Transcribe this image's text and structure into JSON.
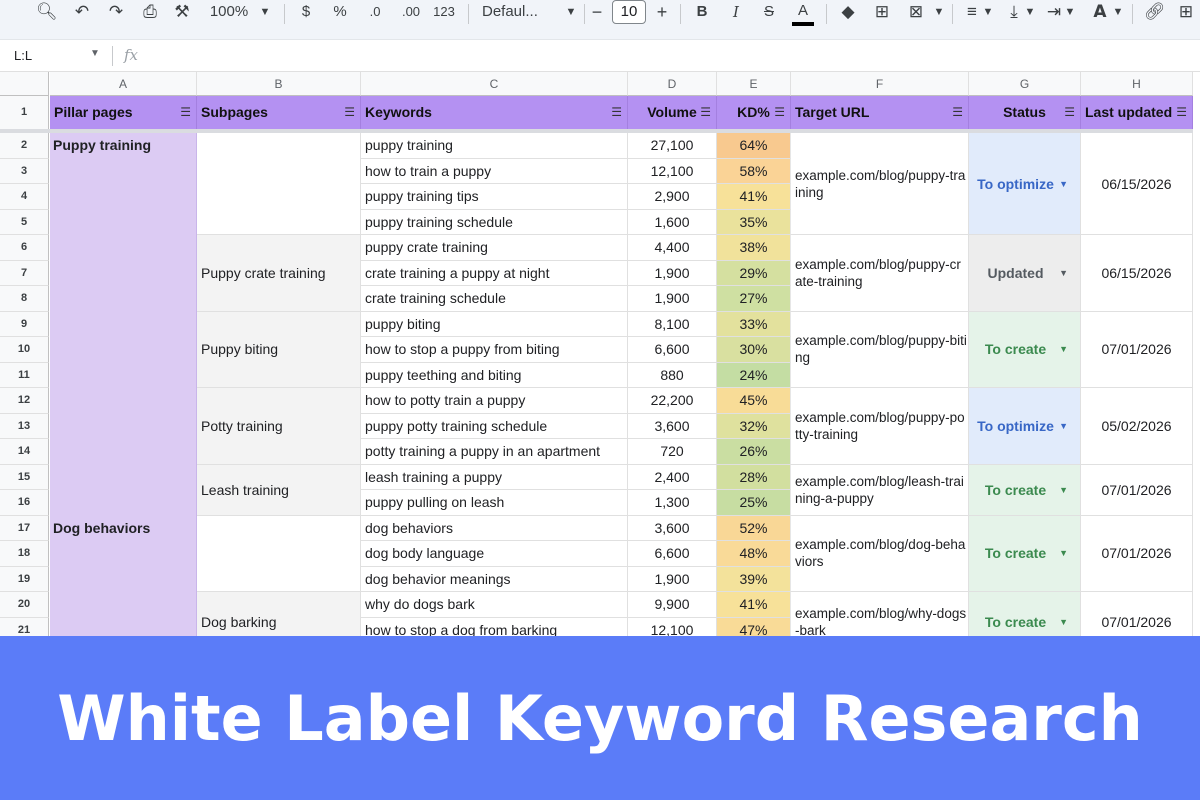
{
  "toolbar": {
    "zoom": "100%",
    "currency": "$",
    "percent": "%",
    "decrease_decimal": ".0",
    "increase_decimal": ".00",
    "more_formats": "123",
    "font": "Defaul...",
    "font_size": "10",
    "bold": "B",
    "italic": "I",
    "strikethrough": "S",
    "text_color": "A",
    "minus": "−",
    "plus": "+"
  },
  "formula_bar": {
    "name_box": "L:L",
    "fx": "fx"
  },
  "columns": [
    "A",
    "B",
    "C",
    "D",
    "E",
    "F",
    "G",
    "H"
  ],
  "rows": [
    "1",
    "2",
    "3",
    "4",
    "5",
    "6",
    "7",
    "8",
    "9",
    "10",
    "11",
    "12",
    "13",
    "14",
    "15",
    "16",
    "17",
    "18",
    "19",
    "20",
    "21"
  ],
  "headers": {
    "pillar": "Pillar pages",
    "subpages": "Subpages",
    "keywords": "Keywords",
    "volume": "Volume",
    "kd": "KD%",
    "url": "Target URL",
    "status": "Status",
    "updated": "Last updated"
  },
  "keywords": [
    {
      "keyword": "puppy training",
      "volume": "27,100",
      "kd": "64%",
      "kd_color": "#f8c98f"
    },
    {
      "keyword": "how to train a puppy",
      "volume": "12,100",
      "kd": "58%",
      "kd_color": "#fad396"
    },
    {
      "keyword": "puppy training tips",
      "volume": "2,900",
      "kd": "41%",
      "kd_color": "#f7e199"
    },
    {
      "keyword": "puppy training schedule",
      "volume": "1,600",
      "kd": "35%",
      "kd_color": "#eae29c"
    },
    {
      "keyword": "puppy crate training",
      "volume": "4,400",
      "kd": "38%",
      "kd_color": "#f1e29b"
    },
    {
      "keyword": "crate training a puppy at night",
      "volume": "1,900",
      "kd": "29%",
      "kd_color": "#d5e0a0"
    },
    {
      "keyword": "crate training schedule",
      "volume": "1,900",
      "kd": "27%",
      "kd_color": "#cfe0a2"
    },
    {
      "keyword": "puppy biting",
      "volume": "8,100",
      "kd": "33%",
      "kd_color": "#e3e19d"
    },
    {
      "keyword": "how to stop a puppy from biting",
      "volume": "6,600",
      "kd": "30%",
      "kd_color": "#d9e0a0"
    },
    {
      "keyword": "puppy teething and biting",
      "volume": "880",
      "kd": "24%",
      "kd_color": "#c4dda3"
    },
    {
      "keyword": "how to potty train a puppy",
      "volume": "22,200",
      "kd": "45%",
      "kd_color": "#f8dc97"
    },
    {
      "keyword": "puppy potty training schedule",
      "volume": "3,600",
      "kd": "32%",
      "kd_color": "#dfe19e"
    },
    {
      "keyword": "potty training a puppy in an apartment",
      "volume": "720",
      "kd": "26%",
      "kd_color": "#cadea2"
    },
    {
      "keyword": "leash training a puppy",
      "volume": "2,400",
      "kd": "28%",
      "kd_color": "#d2df9f"
    },
    {
      "keyword": "puppy pulling on leash",
      "volume": "1,300",
      "kd": "25%",
      "kd_color": "#c7dda2"
    },
    {
      "keyword": "dog behaviors",
      "volume": "3,600",
      "kd": "52%",
      "kd_color": "#f9d796"
    },
    {
      "keyword": "dog body language",
      "volume": "6,600",
      "kd": "48%",
      "kd_color": "#f9da98"
    },
    {
      "keyword": "dog behavior meanings",
      "volume": "1,900",
      "kd": "39%",
      "kd_color": "#f3e29b"
    },
    {
      "keyword": "why do dogs bark",
      "volume": "9,900",
      "kd": "41%",
      "kd_color": "#f7e199"
    },
    {
      "keyword": "how to stop a dog from barking",
      "volume": "12,100",
      "kd": "47%",
      "kd_color": "#f9db97"
    }
  ],
  "pillars": [
    {
      "label": "Puppy training"
    },
    {
      "label": "Dog behaviors"
    }
  ],
  "subpages": [
    {
      "label": ""
    },
    {
      "label": "Puppy crate training"
    },
    {
      "label": "Puppy biting"
    },
    {
      "label": "Potty training"
    },
    {
      "label": "Leash training"
    },
    {
      "label": ""
    },
    {
      "label": "Dog barking"
    }
  ],
  "groups": [
    {
      "url": "example.com/blog/puppy-training",
      "status": "To optimize",
      "status_kind": "optimize",
      "updated": "06/15/2026"
    },
    {
      "url": "example.com/blog/puppy-crate-training",
      "status": "Updated",
      "status_kind": "updated",
      "updated": "06/15/2026"
    },
    {
      "url": "example.com/blog/puppy-biting",
      "status": "To create",
      "status_kind": "create",
      "updated": "07/01/2026"
    },
    {
      "url": "example.com/blog/puppy-potty-training",
      "status": "To optimize",
      "status_kind": "optimize",
      "updated": "05/02/2026"
    },
    {
      "url": "example.com/blog/leash-training-a-puppy",
      "status": "To create",
      "status_kind": "create",
      "updated": "07/01/2026"
    },
    {
      "url": "example.com/blog/dog-behaviors",
      "status": "To create",
      "status_kind": "create",
      "updated": "07/01/2026"
    },
    {
      "url": "example.com/blog/why-dogs-bark",
      "status": "To create",
      "status_kind": "create",
      "updated": "07/01/2026"
    }
  ],
  "banner": {
    "title": "White Label Keyword Research"
  },
  "colors": {
    "header_purple": "#b491f2",
    "pillar_lavender": "#dccbf3",
    "banner_blue": "#5b7cf8"
  }
}
